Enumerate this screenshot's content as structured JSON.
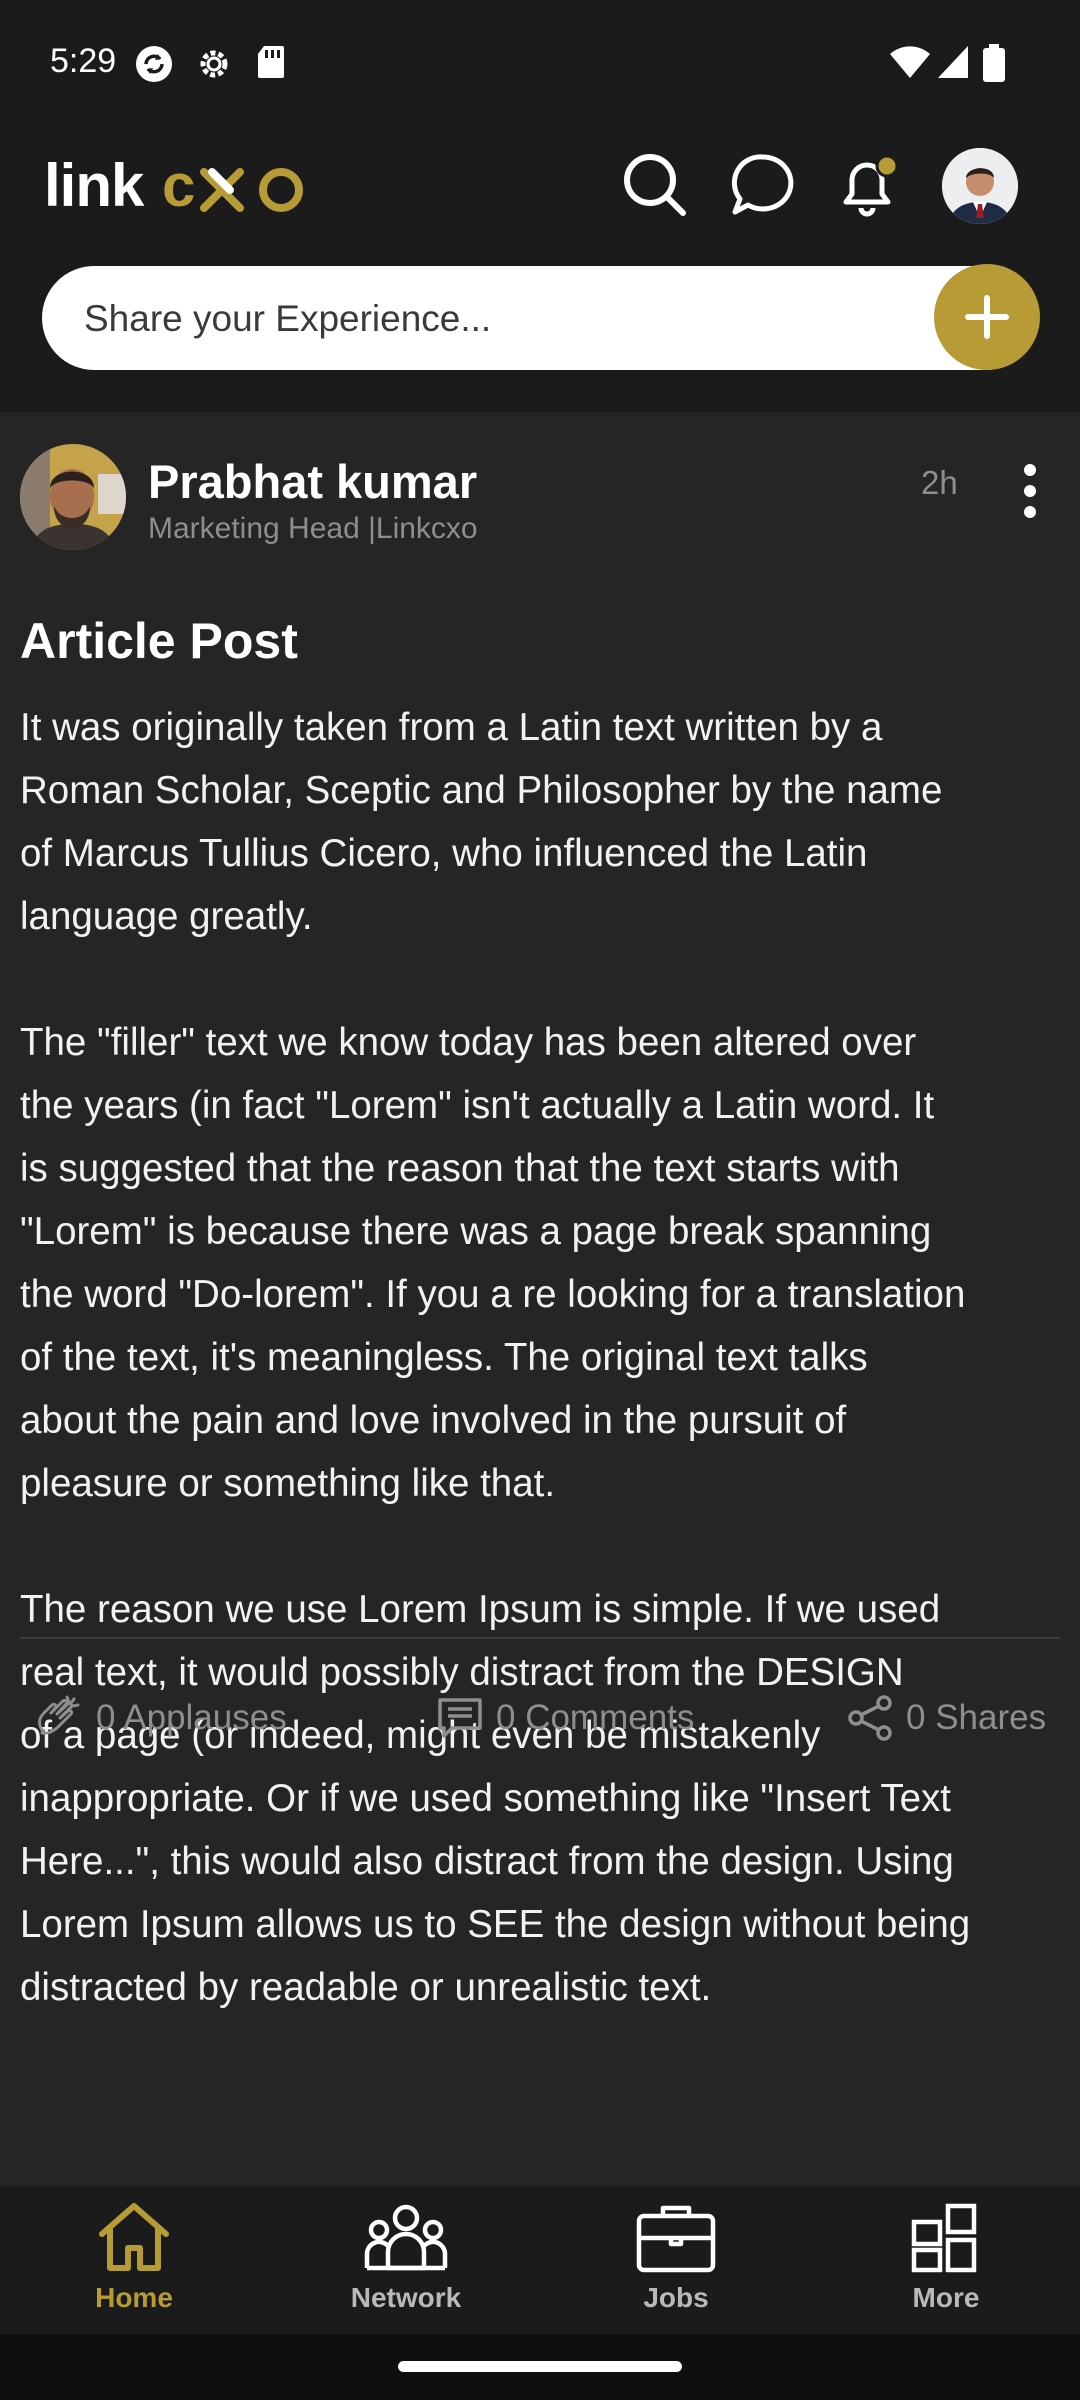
{
  "status_bar": {
    "time": "5:29"
  },
  "header": {
    "logo_text": "linkcxo",
    "icons": [
      "search-icon",
      "chat-icon",
      "bell-icon"
    ],
    "accent_color": "#b79b35"
  },
  "share": {
    "placeholder": "Share your Experience..."
  },
  "post": {
    "author_name": "Prabhat kumar",
    "author_title": "Marketing Head |Linkcxo",
    "time_ago": "2h",
    "title": "Article Post",
    "body": "It was originally taken from a Latin text written by a\nRoman Scholar, Sceptic and Philosopher by the name\nof Marcus Tullius Cicero, who influenced the Latin\nlanguage greatly.\n\nThe \"filler\" text we know today has been altered over\nthe years (in fact \"Lorem\" isn't actually a Latin word. It\nis suggested that the reason that the text starts with\n\"Lorem\" is because there was a page break spanning\nthe word \"Do-lorem\". If you a re looking for a translation\nof the text, it's meaningless. The original text talks\nabout the pain and love involved in the pursuit of\npleasure or something like that.\n\nThe reason we use Lorem Ipsum is simple. If we used\nreal text, it would possibly distract from the DESIGN\nof a page (or indeed, might even be mistakenly\ninappropriate. Or if we used something like \"Insert Text\nHere...\", this would also distract from the design. Using\nLorem Ipsum allows us to SEE the design without being\ndistracted by readable or unrealistic text.",
    "applauses": "0 Applauses",
    "comments": "0 Comments",
    "shares": "0 Shares"
  },
  "bottom_nav": {
    "items": [
      {
        "label": "Home",
        "icon": "home-icon",
        "active": true
      },
      {
        "label": "Network",
        "icon": "network-icon",
        "active": false
      },
      {
        "label": "Jobs",
        "icon": "briefcase-icon",
        "active": false
      },
      {
        "label": "More",
        "icon": "grid-icon",
        "active": false
      }
    ]
  }
}
